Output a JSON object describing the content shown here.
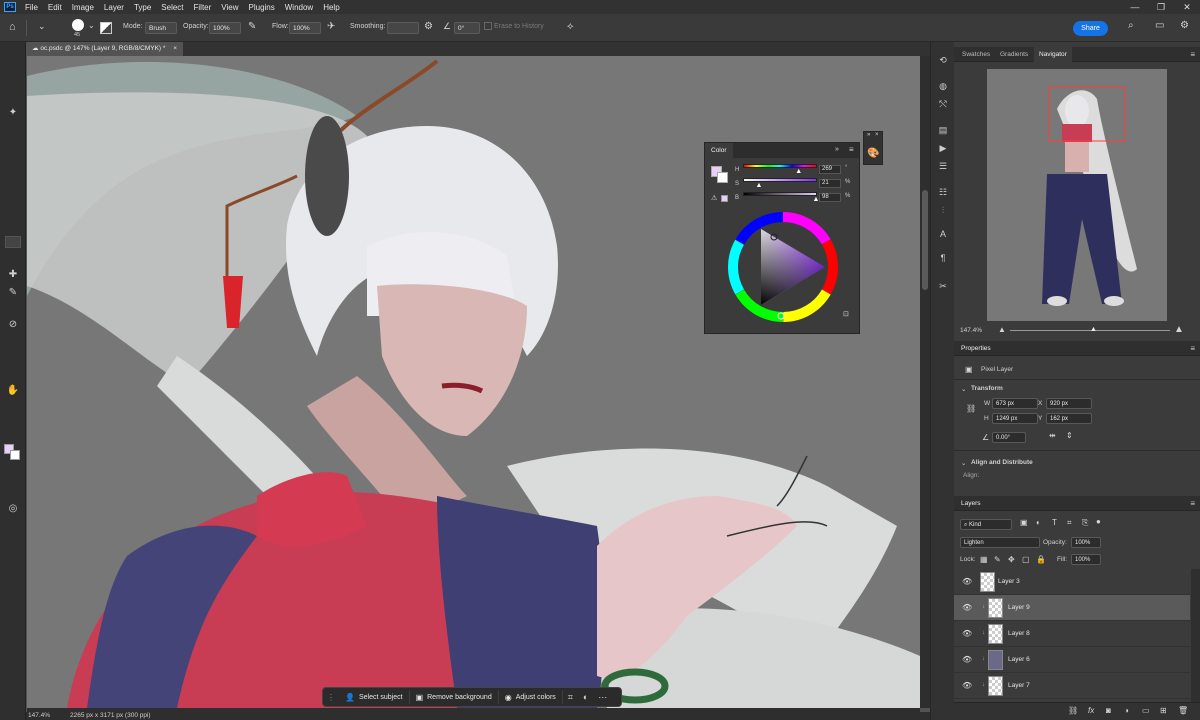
{
  "app": {
    "logo": "Ps",
    "menu": [
      "File",
      "Edit",
      "Image",
      "Layer",
      "Type",
      "Select",
      "Filter",
      "View",
      "Plugins",
      "Window",
      "Help"
    ],
    "window_controls": [
      "—",
      "❐",
      "✕"
    ]
  },
  "options": {
    "brush_size": "45",
    "mode_label": "Mode:",
    "mode_value": "Brush",
    "opacity_label": "Opacity:",
    "opacity_value": "100%",
    "flow_label": "Flow:",
    "flow_value": "100%",
    "smoothing_label": "Smoothing:",
    "smoothing_value": "",
    "angle_value": "0°",
    "erase_history": "Erase to History",
    "share": "Share"
  },
  "document": {
    "tab_title": "oc.psdc @ 147% (Layer 9, RGB/8/CMYK) *",
    "close": "×"
  },
  "status": {
    "zoom": "147.4%",
    "info": "2265 px x 3171 px (300 ppi)"
  },
  "taskbar": {
    "select_subject": "Select subject",
    "remove_background": "Remove background",
    "adjust_colors": "Adjust colors"
  },
  "color_panel": {
    "tab": "Color",
    "h_label": "H",
    "h_value": "269",
    "h_unit": "°",
    "s_label": "S",
    "s_value": "21",
    "s_unit": "%",
    "b_label": "B",
    "b_value": "98",
    "b_unit": "%",
    "h_fraction": 0.747,
    "s_fraction": 0.21,
    "b_fraction": 0.98,
    "foreground_color": "#e8cff7",
    "background_color": "#ffffff"
  },
  "navigator": {
    "tabs": [
      "Swatches",
      "Gradients",
      "Navigator"
    ],
    "zoom": "147.4%"
  },
  "properties": {
    "title": "Properties",
    "layer_type": "Pixel Layer",
    "transform_label": "Transform",
    "w_label": "W",
    "w_value": "673 px",
    "h_label": "H",
    "h_value": "1249 px",
    "x_label": "X",
    "x_value": "920 px",
    "y_label": "Y",
    "y_value": "162 px",
    "angle_value": "0.00°",
    "align_label": "Align and Distribute",
    "align_sub": "Align:"
  },
  "layers": {
    "title": "Layers",
    "filter_label": "Kind",
    "blend_mode": "Lighten",
    "opacity_label": "Opacity:",
    "opacity_value": "100%",
    "lock_label": "Lock:",
    "fill_label": "Fill:",
    "fill_value": "100%",
    "items": [
      {
        "name": "Layer 3",
        "selected": false
      },
      {
        "name": "Layer 9",
        "selected": true
      },
      {
        "name": "Layer 8",
        "selected": false
      },
      {
        "name": "Layer 6",
        "selected": false
      },
      {
        "name": "Layer 7",
        "selected": false
      }
    ],
    "footer_icons": [
      "link-icon",
      "fx-icon",
      "mask-icon",
      "adjustment-icon",
      "group-icon",
      "new-layer-icon",
      "trash-icon"
    ]
  },
  "colors": {
    "accent": "#1473e6",
    "canvas_bg": "#777777",
    "navigator_box": "#ff3b3b"
  }
}
